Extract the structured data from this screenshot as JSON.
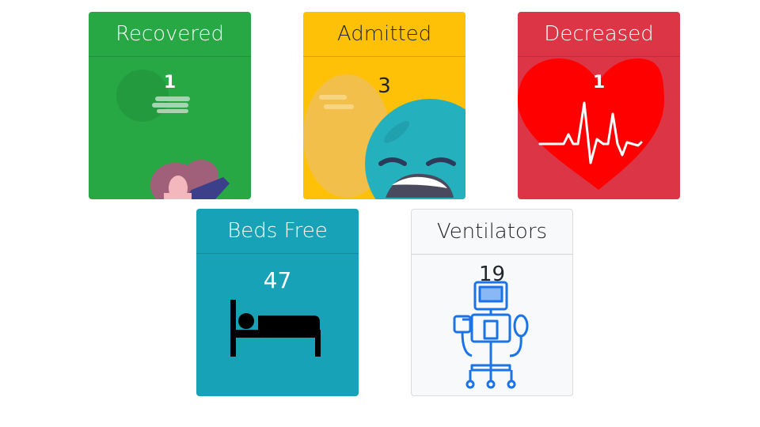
{
  "cards": [
    {
      "title": "Recovered",
      "count": "1"
    },
    {
      "title": "Admitted",
      "count": "3"
    },
    {
      "title": "Decreased",
      "count": "1"
    },
    {
      "title": "Beds Free",
      "count": "47"
    },
    {
      "title": "Ventilators",
      "count": "19"
    }
  ],
  "colors": {
    "recovered": "#28a745",
    "admitted": "#ffc107",
    "deceased": "#dc3545",
    "beds": "#17a2b8",
    "ventilators": "#f8f9fa",
    "icon_blue": "#1a73e8"
  },
  "icons": [
    "recovered-person-illustration",
    "sleepy-face-illustration",
    "heartbeat-icon",
    "bed-icon",
    "ventilator-icon"
  ]
}
